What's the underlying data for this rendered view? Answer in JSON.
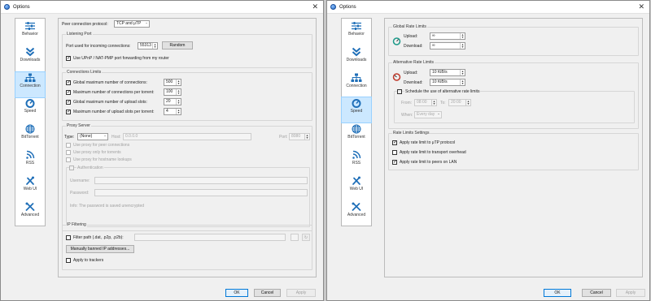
{
  "window_title": "Options",
  "sidebar": [
    {
      "label": "Behavior",
      "icon": "sliders-icon"
    },
    {
      "label": "Downloads",
      "icon": "double-chevron-down-icon"
    },
    {
      "label": "Connection",
      "icon": "network-icon"
    },
    {
      "label": "Speed",
      "icon": "speedometer-icon"
    },
    {
      "label": "BitTorrent",
      "icon": "globe-icon"
    },
    {
      "label": "RSS",
      "icon": "rss-icon"
    },
    {
      "label": "Web UI",
      "icon": "tools-icon"
    },
    {
      "label": "Advanced",
      "icon": "wrench-screwdriver-icon"
    }
  ],
  "left_selected": "Connection",
  "right_selected": "Speed",
  "connection": {
    "protocol_label": "Peer connection protocol:",
    "protocol_value": "TCP and μTP",
    "listening": {
      "title": "Listening Port",
      "port_label": "Port used for incoming connections:",
      "port_value": "55313",
      "random_button": "Random",
      "upnp_label": "Use UPnP / NAT-PMP port forwarding from my router",
      "upnp_checked": true
    },
    "limits": {
      "title": "Connections Limits",
      "rows": [
        {
          "label": "Global maximum number of connections:",
          "value": "500",
          "checked": true
        },
        {
          "label": "Maximum number of connections per torrent:",
          "value": "100",
          "checked": true
        },
        {
          "label": "Global maximum number of upload slots:",
          "value": "20",
          "checked": true
        },
        {
          "label": "Maximum number of upload slots per torrent:",
          "value": "4",
          "checked": true
        }
      ]
    },
    "proxy": {
      "title": "Proxy Server",
      "type_label": "Type:",
      "type_value": "(None)",
      "host_label": "Host:",
      "host_value": "0.0.0.0",
      "port_label": "Port:",
      "port_value": "8080",
      "options": [
        "Use proxy for peer connections",
        "Use proxy only for torrents",
        "Use proxy for hostname lookups"
      ],
      "auth": {
        "title": "Authentication",
        "username_label": "Username:",
        "password_label": "Password:",
        "info": "Info: The password is saved unencrypted"
      }
    },
    "ipfilter": {
      "title": "IP Filtering",
      "filter_label": "Filter path (.dat, .p2p, .p2b):",
      "banned_button": "Manually banned IP addresses...",
      "trackers_label": "Apply to trackers"
    }
  },
  "speed": {
    "global": {
      "title": "Global Rate Limits",
      "upload_label": "Upload:",
      "upload_value": "∞",
      "download_label": "Download:",
      "download_value": "∞"
    },
    "alternative": {
      "title": "Alternative Rate Limits",
      "upload_label": "Upload:",
      "upload_value": "10 KiB/s",
      "download_label": "Download:",
      "download_value": "10 KiB/s",
      "schedule_label": "Schedule the use of alternative rate limits",
      "from_label": "From:",
      "from_value": "08:00",
      "to_label": "To:",
      "to_value": "20:00",
      "when_label": "When:",
      "when_value": "Every day"
    },
    "settings": {
      "title": "Rate Limits Settings",
      "options": [
        {
          "label": "Apply rate limit to μTP protocol",
          "checked": true
        },
        {
          "label": "Apply rate limit to transport overhead",
          "checked": false
        },
        {
          "label": "Apply rate limit to peers on LAN",
          "checked": true
        }
      ]
    }
  },
  "buttons": {
    "ok": "OK",
    "cancel": "Cancel",
    "apply": "Apply"
  }
}
